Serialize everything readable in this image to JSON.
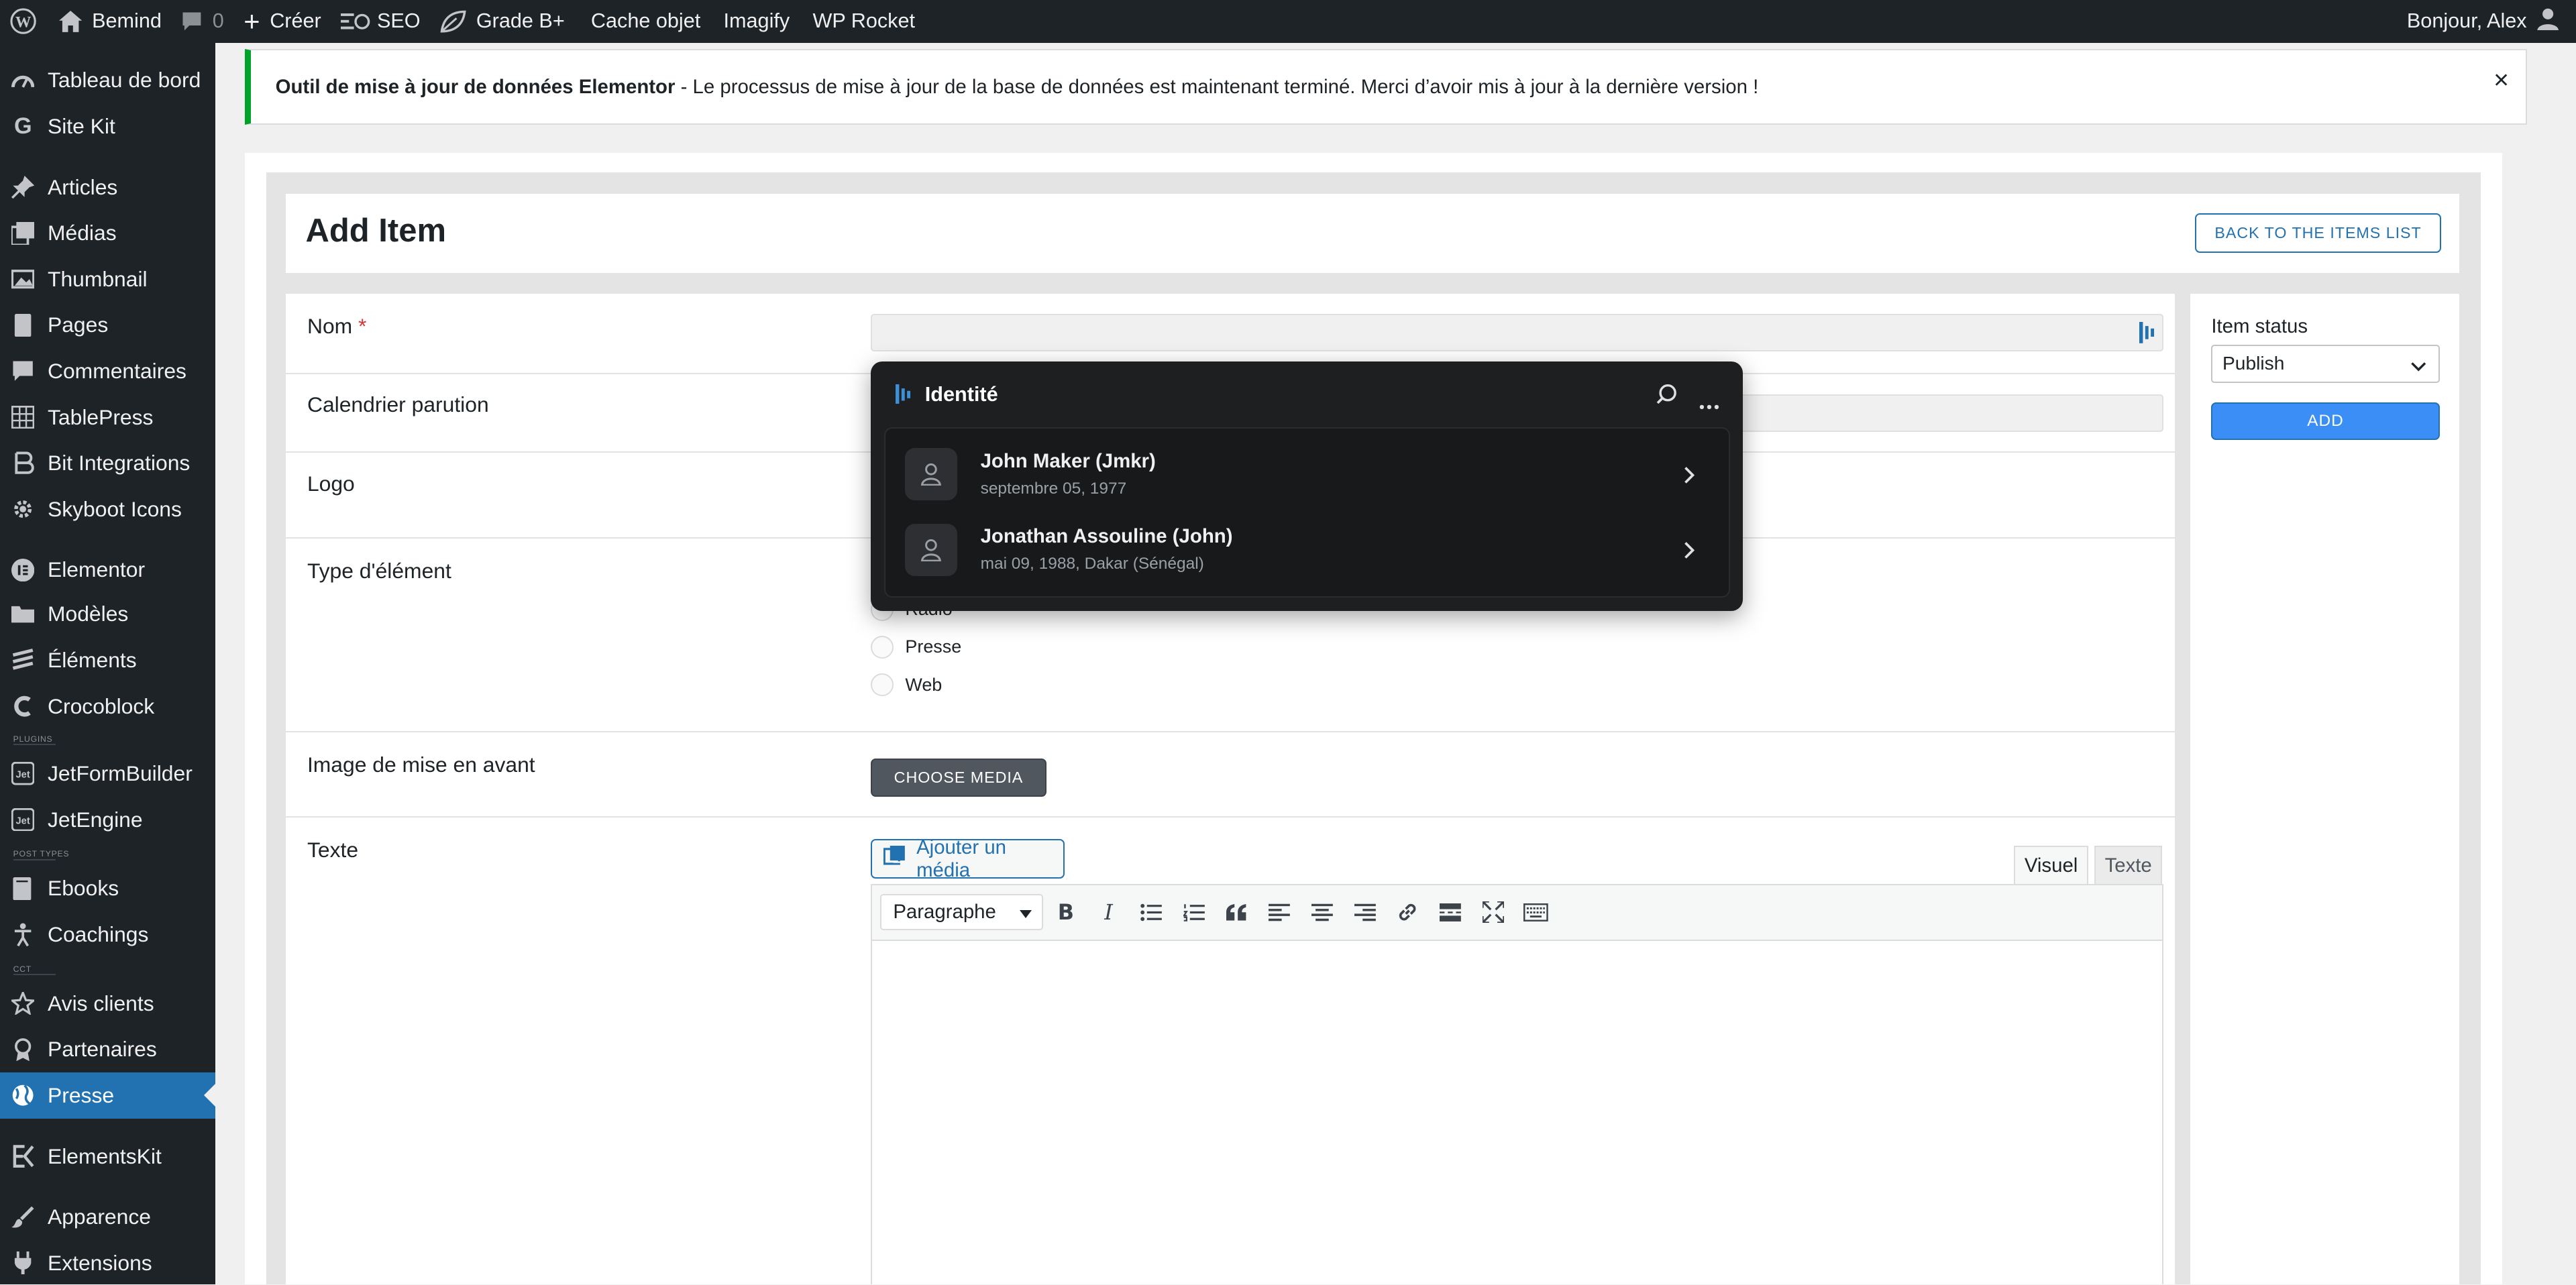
{
  "admin_bar": {
    "site_name": "Bemind",
    "comments_count": "0",
    "create_label": "Créer",
    "seo_label": "SEO",
    "grade_label": "Grade B+",
    "cache_label": "Cache objet",
    "imagify_label": "Imagify",
    "rocket_label": "WP Rocket",
    "greeting": "Bonjour, Alex"
  },
  "sidebar": {
    "items": [
      {
        "label": "Tableau de bord",
        "icon": "dashboard-icon"
      },
      {
        "label": "Site Kit",
        "icon": "google-icon"
      },
      {
        "label": "Articles",
        "icon": "pin-icon"
      },
      {
        "label": "Médias",
        "icon": "media-icon"
      },
      {
        "label": "Thumbnail",
        "icon": "image-icon"
      },
      {
        "label": "Pages",
        "icon": "page-icon"
      },
      {
        "label": "Commentaires",
        "icon": "comment-icon"
      },
      {
        "label": "TablePress",
        "icon": "table-icon"
      },
      {
        "label": "Bit Integrations",
        "icon": "integration-icon"
      },
      {
        "label": "Skyboot Icons",
        "icon": "gear-icon"
      },
      {
        "label": "Elementor",
        "icon": "elementor-icon"
      },
      {
        "label": "Modèles",
        "icon": "folder-icon"
      },
      {
        "label": "Éléments",
        "icon": "elements-icon"
      },
      {
        "label": "Crocoblock",
        "icon": "crocoblock-icon"
      },
      {
        "label": "JetFormBuilder",
        "icon": "jet-icon"
      },
      {
        "label": "JetEngine",
        "icon": "jet-icon"
      },
      {
        "label": "Ebooks",
        "icon": "book-icon"
      },
      {
        "label": "Coachings",
        "icon": "person-icon"
      },
      {
        "label": "Avis clients",
        "icon": "star-icon"
      },
      {
        "label": "Partenaires",
        "icon": "award-icon"
      },
      {
        "label": "Presse",
        "icon": "globe-icon"
      },
      {
        "label": "ElementsKit",
        "icon": "elementskit-icon"
      },
      {
        "label": "Apparence",
        "icon": "brush-icon"
      },
      {
        "label": "Extensions",
        "icon": "plugin-icon"
      }
    ],
    "separators": [
      "PLUGINS",
      "POST TYPES",
      "CCT"
    ]
  },
  "notice": {
    "title": "Outil de mise à jour de données Elementor",
    "message": " - Le processus de mise à jour de la base de données est maintenant terminé. Merci d’avoir mis à jour à la dernière version !",
    "close": "×"
  },
  "page": {
    "title": "Add Item",
    "back_button": "BACK TO THE ITEMS LIST"
  },
  "form": {
    "nom_label": "Nom",
    "required_mark": "*",
    "calendrier_label": "Calendrier parution",
    "logo_label": "Logo",
    "type_label": "Type d'élément",
    "type_options": [
      "Radio",
      "Presse",
      "Web"
    ],
    "image_label": "Image de mise en avant",
    "choose_media": "CHOOSE MEDIA",
    "texte_label": "Texte",
    "add_media": "Ajouter un média",
    "tab_visual": "Visuel",
    "tab_text": "Texte",
    "format_select": "Paragraphe"
  },
  "side": {
    "status_label": "Item status",
    "status_value": "Publish",
    "add_button": "ADD"
  },
  "popup": {
    "title": "Identité",
    "items": [
      {
        "name": "John Maker (Jmkr)",
        "sub": "septembre 05, 1977"
      },
      {
        "name": "Jonathan Assouline (John)",
        "sub": "mai 09, 1988, Dakar (Sénégal)"
      }
    ]
  },
  "colors": {
    "admin_bg": "#1d2327",
    "accent": "#2271b1",
    "notice_success": "#00a32a",
    "add_button": "#3a8ef6",
    "popup_bg": "#1e1f21"
  }
}
